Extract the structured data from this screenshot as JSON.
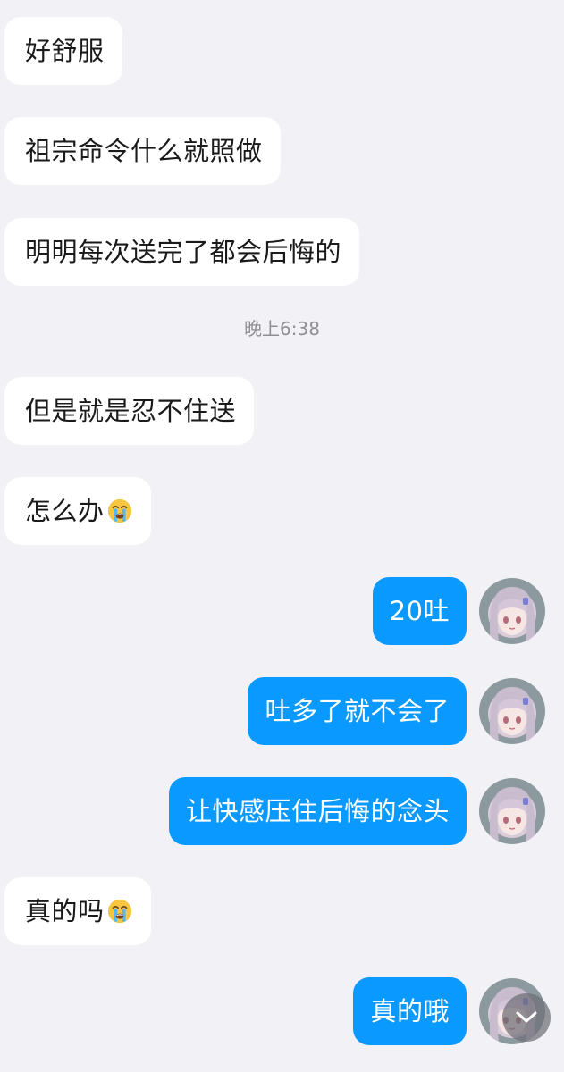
{
  "messages": [
    {
      "side": "in",
      "text": "好舒服"
    },
    {
      "side": "in",
      "text": "祖宗命令什么就照做"
    },
    {
      "side": "in",
      "text": "明明每次送完了都会后悔的"
    },
    {
      "side": "in",
      "text": "但是就是忍不住送"
    },
    {
      "side": "in",
      "text": "怎么办",
      "emoji": "loudly-crying-face"
    },
    {
      "side": "out",
      "text": "20吐"
    },
    {
      "side": "out",
      "text": "吐多了就不会了"
    },
    {
      "side": "out",
      "text": "让快感压住后悔的念头"
    },
    {
      "side": "in",
      "text": "真的吗",
      "emoji": "loudly-crying-face"
    },
    {
      "side": "out",
      "text": "真的哦"
    }
  ],
  "timestamp": "晚上6:38",
  "colors": {
    "background": "#f2f2f6",
    "incoming_bubble": "#ffffff",
    "outgoing_bubble": "#0a99ff",
    "timestamp_text": "#8e8e93"
  },
  "icons": {
    "scroll_to_bottom": "chevron-down-icon",
    "avatar": "user-avatar"
  }
}
